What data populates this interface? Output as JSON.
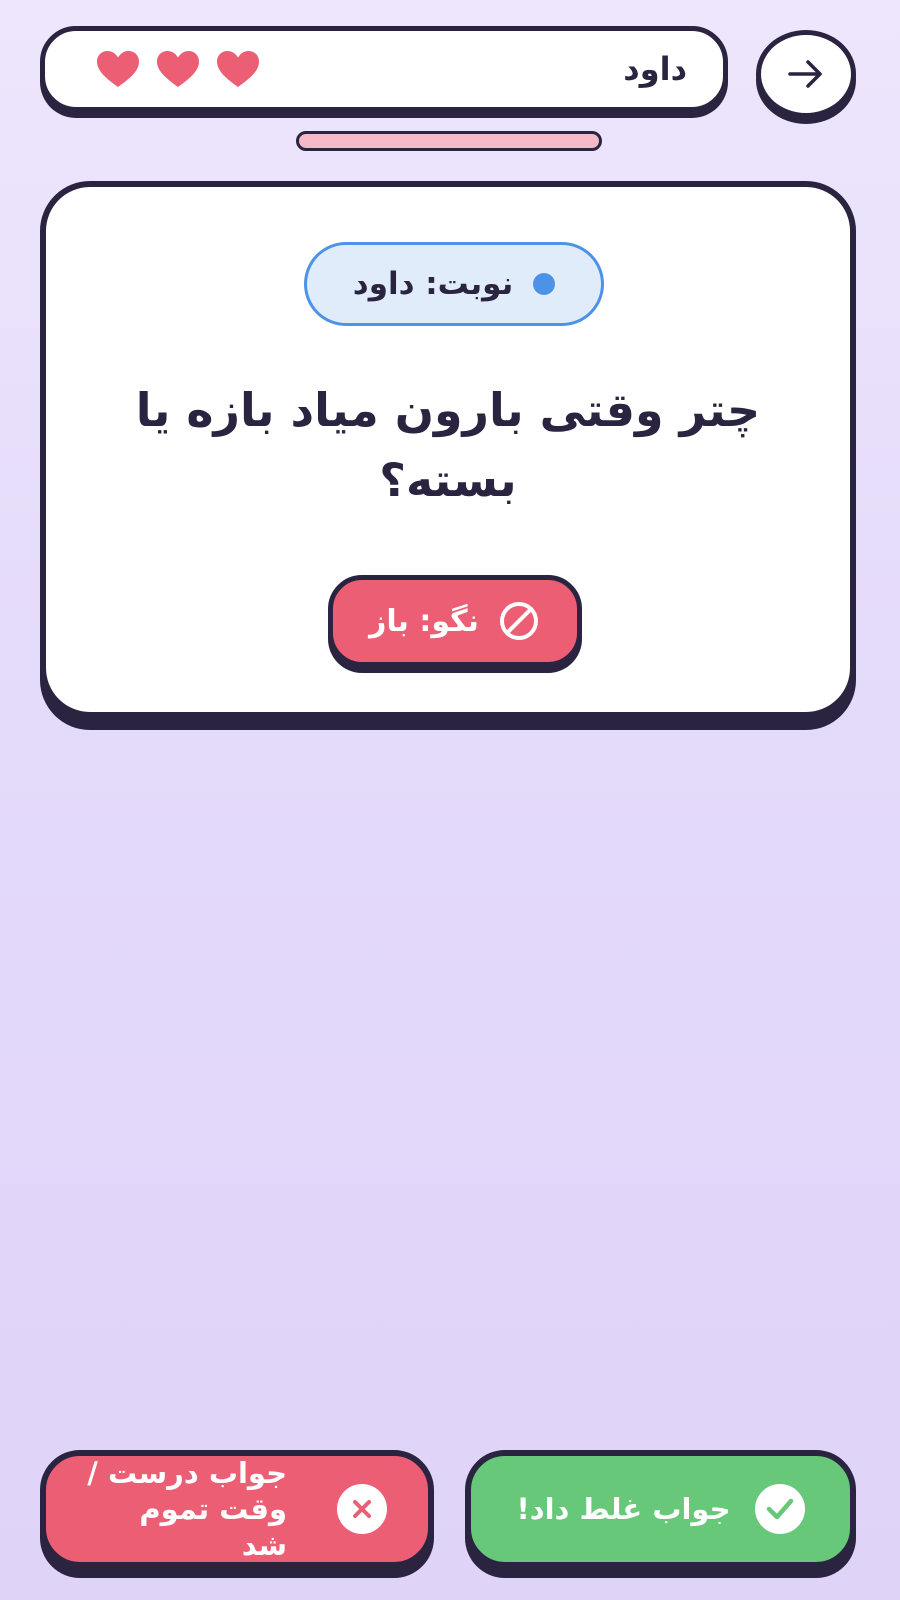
{
  "header": {
    "player_name": "داود",
    "lives": 3,
    "back_icon": "arrow-right-icon",
    "heart_icon": "heart-icon",
    "heart_color": "#EC5E73"
  },
  "timer": {
    "color": "#F5B8C6"
  },
  "card": {
    "turn_label": "نوبت: داود",
    "turn_color": "#4C93E8",
    "question": "چتر وقتی بارون میاد بازه یا بسته؟",
    "forbidden_label": "نگو: باز",
    "forbidden_icon": "ban-icon"
  },
  "actions": {
    "wrong_label_line1": "جواب درست /",
    "wrong_label_line2": "وقت تموم شد",
    "wrong_icon": "x-circle-icon",
    "wrong_color": "#EC5E73",
    "right_label": "جواب غلط داد!",
    "right_icon": "check-circle-icon",
    "right_color": "#66C878"
  }
}
